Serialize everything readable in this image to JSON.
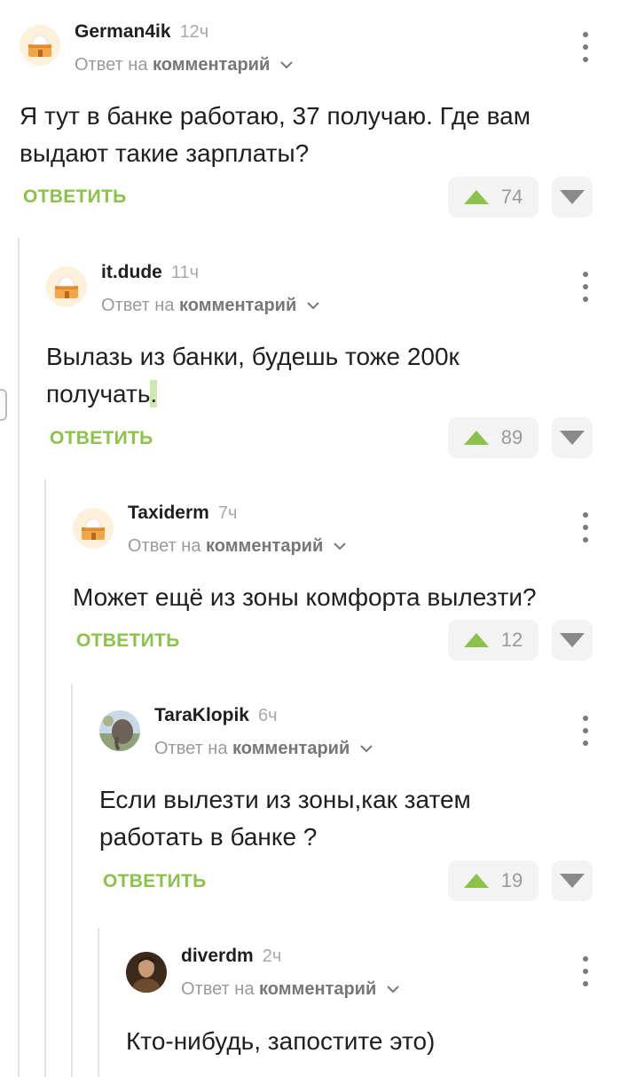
{
  "comments": [
    {
      "author": "German4ik",
      "time": "12ч",
      "reply_prefix": "Ответ на",
      "reply_target": "комментарий",
      "text_lines": [
        "Я тут в банке работаю, 37 получаю. Где вам",
        "выдают такие зарплаты?"
      ],
      "reply_label": "ОТВЕТИТЬ",
      "rating": "74",
      "avatar": "default-cake-avatar"
    },
    {
      "author": "it.dude",
      "time": "11ч",
      "reply_prefix": "Ответ на",
      "reply_target": "комментарий",
      "text_lines": [
        "Вылазь из банки, будешь тоже 200к",
        "получать"
      ],
      "text_tail": ".",
      "reply_label": "ОТВЕТИТЬ",
      "rating": "89",
      "avatar": "default-cake-avatar"
    },
    {
      "author": "Taxiderm",
      "time": "7ч",
      "reply_prefix": "Ответ на",
      "reply_target": "комментарий",
      "text_lines": [
        "Может ещё из зоны комфорта вылезти?"
      ],
      "reply_label": "ОТВЕТИТЬ",
      "rating": "12",
      "avatar": "default-cake-avatar"
    },
    {
      "author": "TaraKlopik",
      "time": "6ч",
      "reply_prefix": "Ответ на",
      "reply_target": "комментарий",
      "text_lines": [
        "Если вылезти из зоны,как затем",
        "работать в банке ?"
      ],
      "reply_label": "ОТВЕТИТЬ",
      "rating": "19",
      "avatar": "photo-avatar-elephant"
    },
    {
      "author": "diverdm",
      "time": "2ч",
      "reply_prefix": "Ответ на",
      "reply_target": "комментарий",
      "text_lines": [
        "Кто-нибудь, запостите это)"
      ],
      "avatar": "photo-avatar-man"
    }
  ],
  "colors": {
    "accent": "#8bc34a",
    "muted": "#9a9a9a",
    "button_bg": "#f3f3f3",
    "thread_line": "#e2e2e2"
  },
  "icons": [
    "arrow-up-icon",
    "arrow-down-icon",
    "more-vertical-icon",
    "chevron-down-icon"
  ]
}
